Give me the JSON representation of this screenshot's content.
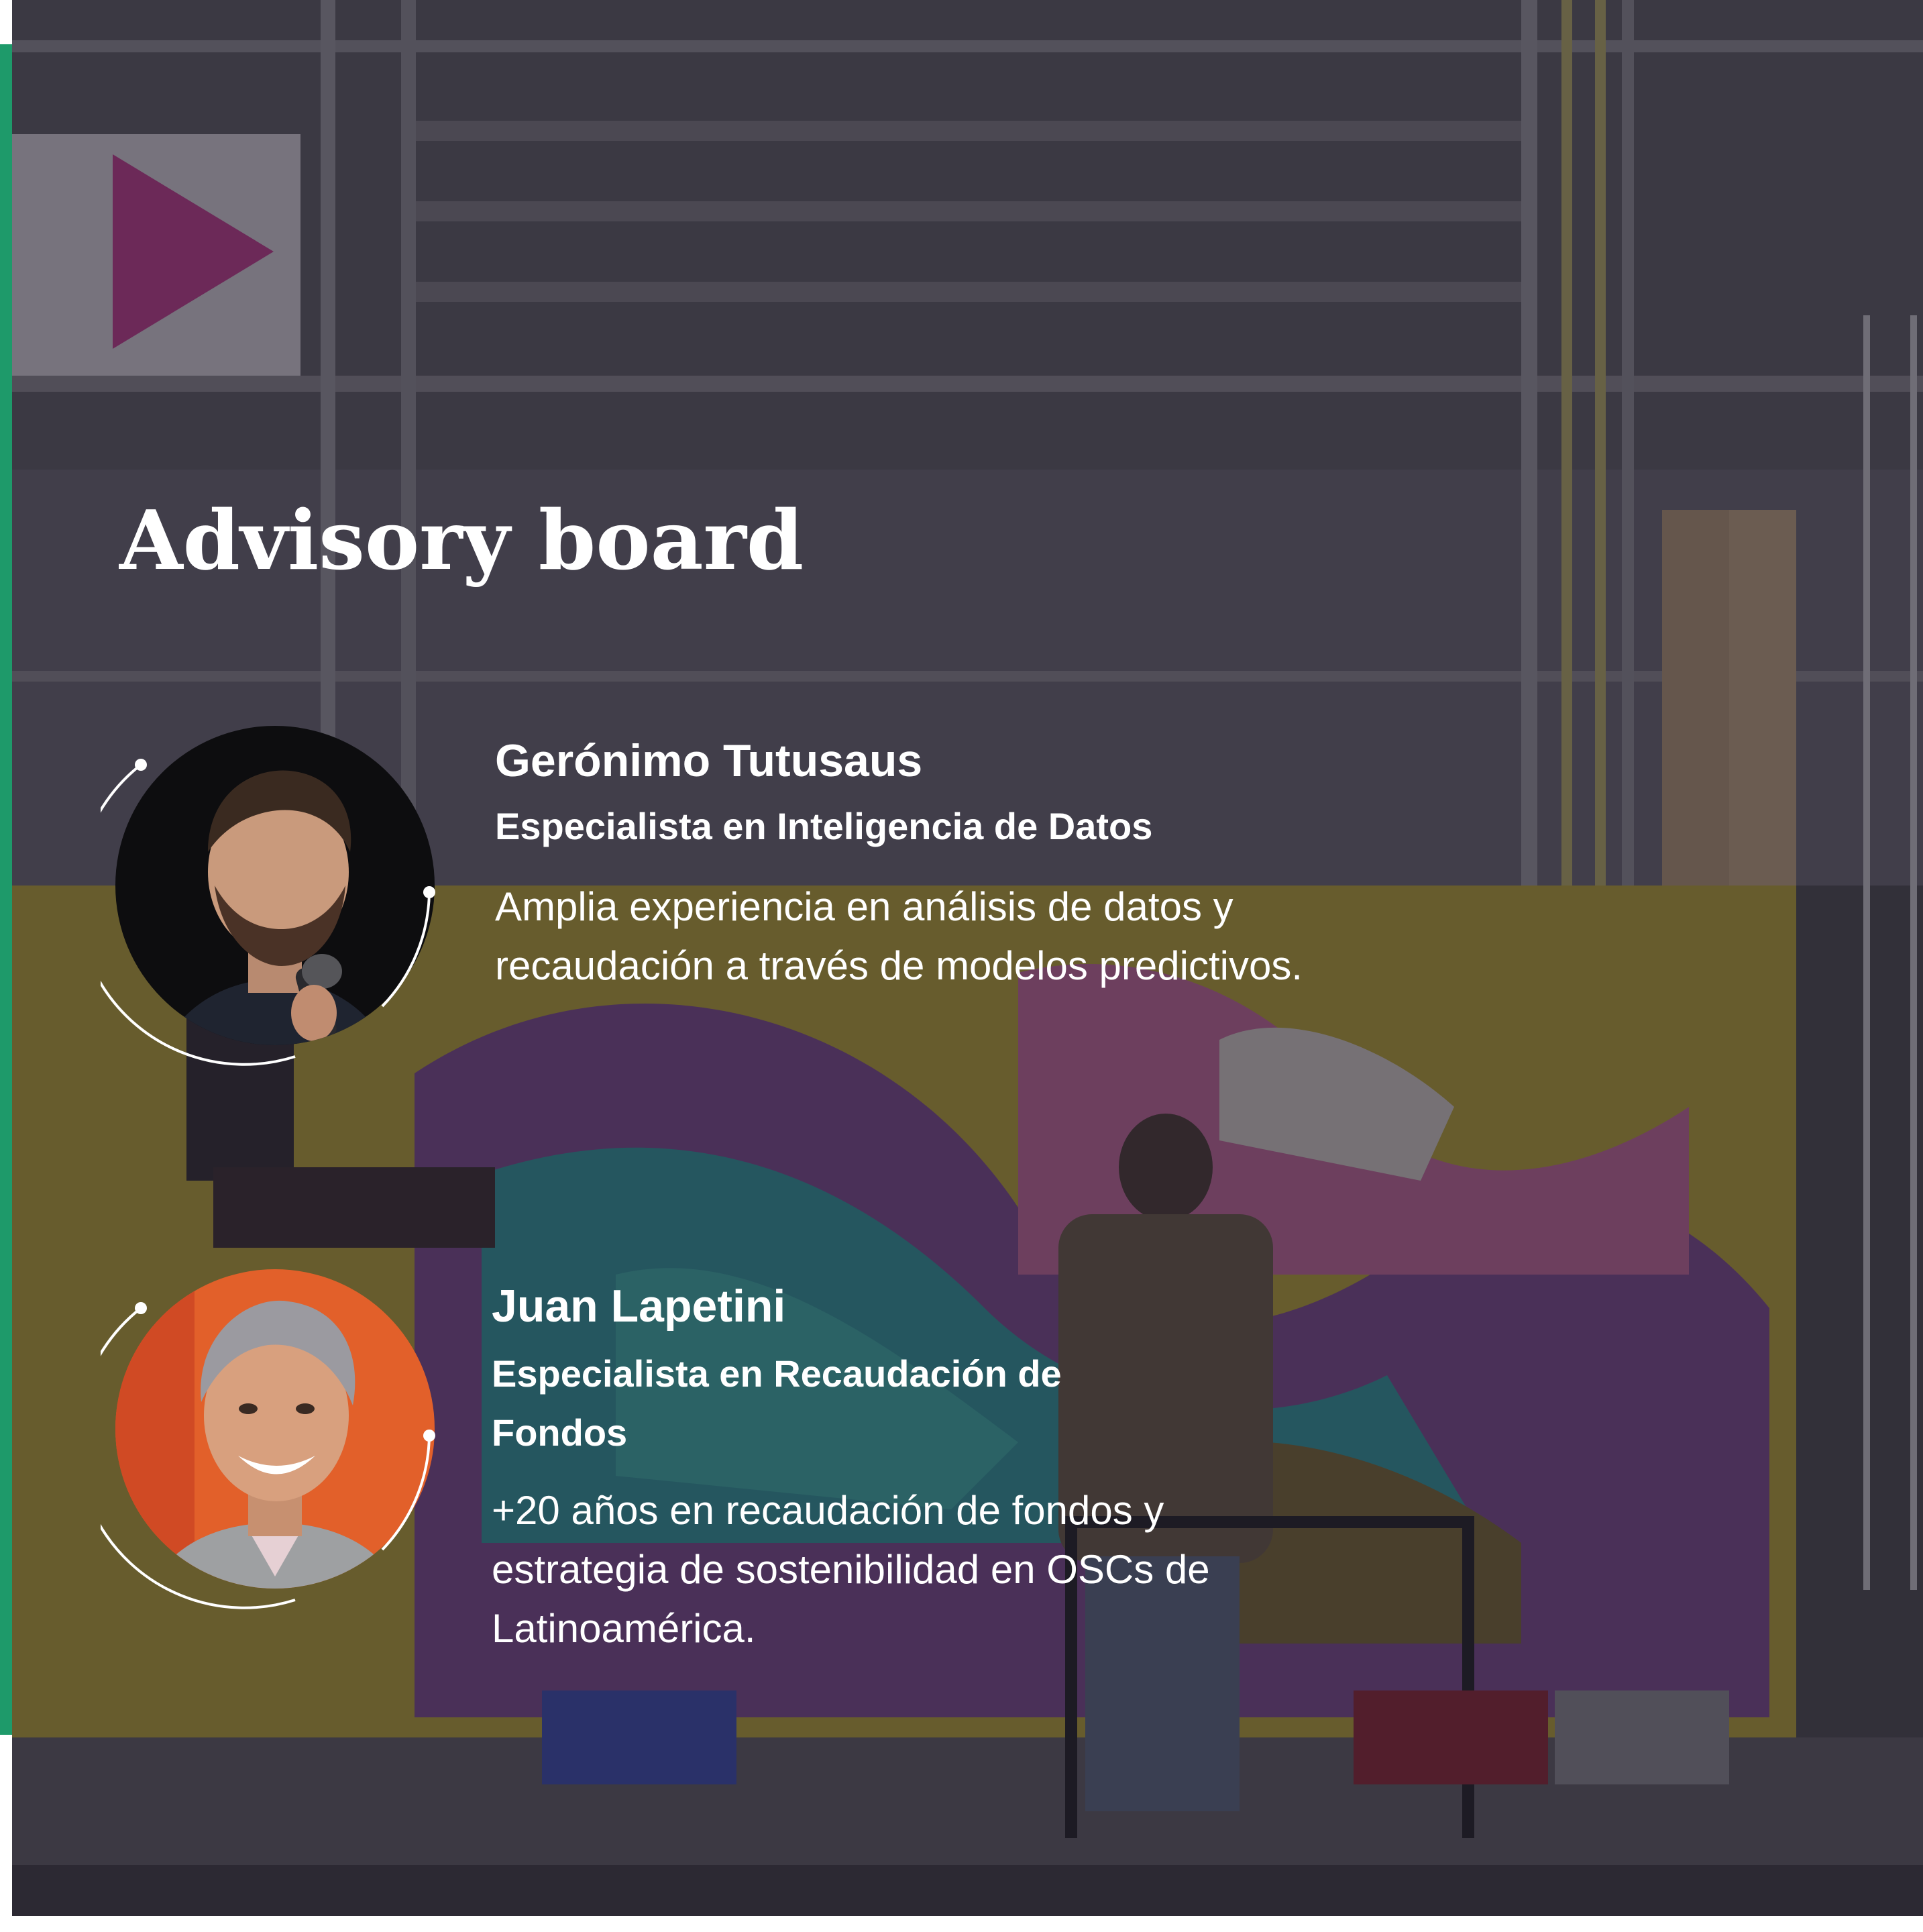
{
  "title": "Advisory board",
  "colors": {
    "accent": "#1e9a6a",
    "text": "#ffffff",
    "overlay": "#1c1828"
  },
  "members": [
    {
      "name": "Gerónimo Tutusaus",
      "role": "Especialista en Inteligencia de Datos",
      "bio": "Amplia experiencia en análisis de datos y recaudación a través de modelos predictivos."
    },
    {
      "name": "Juan Lapetini",
      "role": "Especialista en Recaudación de Fondos",
      "bio": "+20 años en recaudación de fondos y estrategia de sostenibilidad en OSCs de Latinoamérica."
    }
  ]
}
